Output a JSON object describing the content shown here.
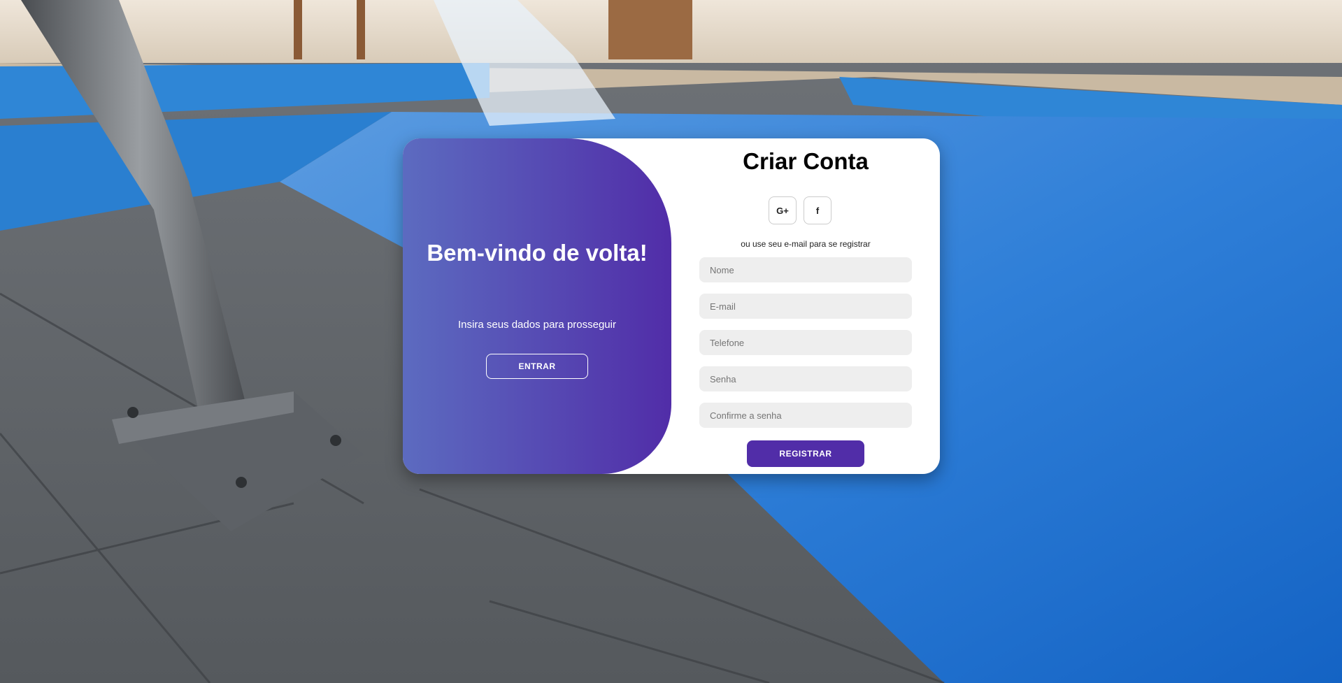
{
  "welcome_panel": {
    "title": "Bem-vindo de volta!",
    "subtitle": "Insira seus dados para prosseguir",
    "enter_label": "ENTRAR"
  },
  "register_form": {
    "title": "Criar Conta",
    "social": {
      "google_label": "G+",
      "google_icon": "google-plus-icon",
      "facebook_label": "f",
      "facebook_icon": "facebook-icon"
    },
    "or_text": "ou use seu e-mail para se registrar",
    "fields": {
      "name_placeholder": "Nome",
      "email_placeholder": "E-mail",
      "phone_placeholder": "Telefone",
      "password_placeholder": "Senha",
      "confirm_placeholder": "Confirme a senha"
    },
    "register_label": "REGISTRAR"
  },
  "colors": {
    "gradient_start": "#5c6bc0",
    "gradient_end": "#512da8",
    "primary": "#512da8",
    "input_bg": "#eeeeee"
  }
}
